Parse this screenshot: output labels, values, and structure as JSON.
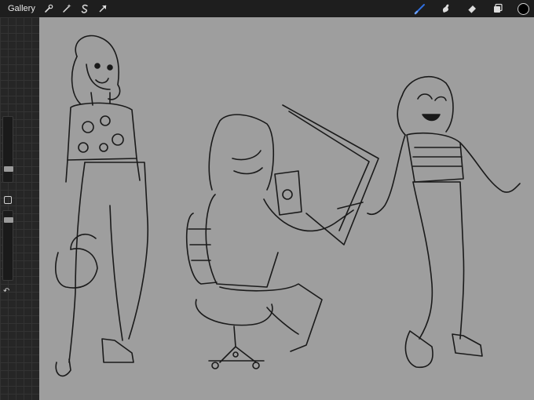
{
  "topbar": {
    "gallery_label": "Gallery",
    "left_tools": [
      "wrench-icon",
      "magic-wand-icon",
      "selection-s-icon",
      "transform-arrow-icon"
    ],
    "right_tools": [
      "brush-icon",
      "smudge-icon",
      "eraser-icon",
      "layers-icon"
    ],
    "active_tool": "brush-icon",
    "accent_color": "#2f6fe0",
    "current_color": "#000000"
  },
  "sidebar": {
    "brush_size_icon": "slider",
    "opacity_icon": "slider",
    "modify_icon": "square-icon",
    "undo_icon": "undo-icon"
  },
  "canvas": {
    "background_color": "#9e9e9e",
    "artwork": "three-character-pencil-sketch"
  }
}
